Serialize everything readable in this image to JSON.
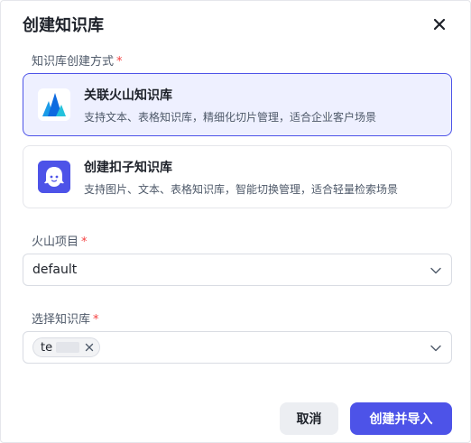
{
  "dialog": {
    "title": "创建知识库",
    "close_icon": "close-icon"
  },
  "method": {
    "label": "知识库创建方式",
    "required_mark": "*",
    "options": [
      {
        "title": "关联火山知识库",
        "desc": "支持文本、表格知识库，精细化切片管理，适合企业客户场景",
        "icon": "volcano-logo",
        "selected": true
      },
      {
        "title": "创建扣子知识库",
        "desc": "支持图片、文本、表格知识库，智能切换管理，适合轻量检索场景",
        "icon": "coze-logo",
        "selected": false
      }
    ]
  },
  "project": {
    "label": "火山项目",
    "required_mark": "*",
    "value": "default",
    "icon": "chevron-down-icon"
  },
  "knowledge": {
    "label": "选择知识库",
    "required_mark": "*",
    "tag_text": "te",
    "icon": "chevron-down-icon"
  },
  "footer": {
    "cancel_label": "取消",
    "submit_label": "创建并导入"
  },
  "colors": {
    "primary": "#4d53e8",
    "selected_bg": "#eef0ff",
    "required": "#f53f3f"
  }
}
